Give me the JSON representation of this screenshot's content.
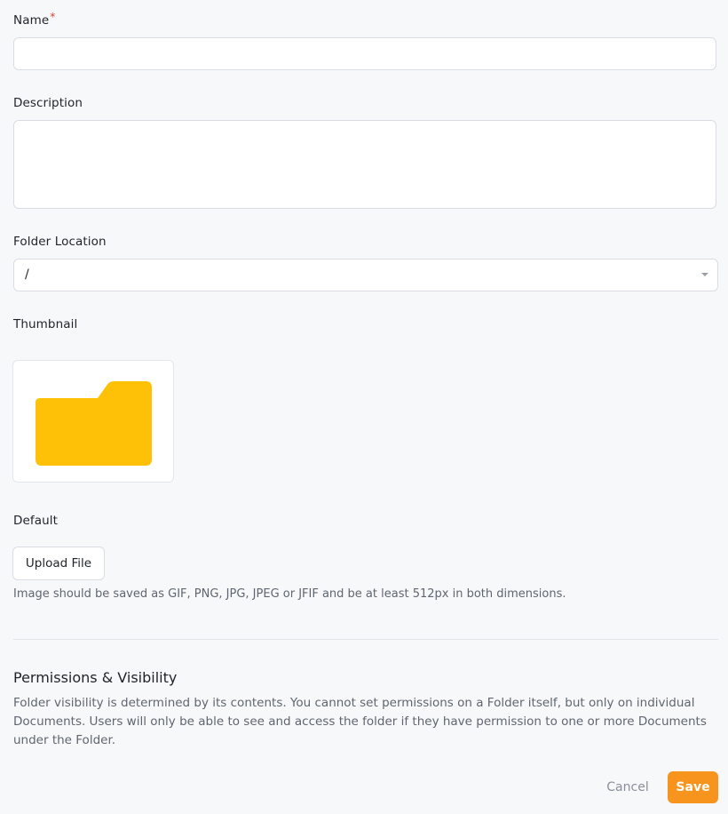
{
  "form": {
    "name": {
      "label": "Name",
      "required_mark": "*",
      "value": "",
      "placeholder": ""
    },
    "description": {
      "label": "Description",
      "value": "",
      "placeholder": ""
    },
    "folder_location": {
      "label": "Folder Location",
      "selected": "/"
    },
    "thumbnail": {
      "label": "Thumbnail",
      "preview_icon": "folder-icon",
      "preview_color": "#FFC107",
      "default_label": "Default",
      "upload_button": "Upload File",
      "hint": "Image should be saved as GIF, PNG, JPG, JPEG or JFIF and be at least 512px in both dimensions."
    }
  },
  "permissions": {
    "title": "Permissions & Visibility",
    "description": "Folder visibility is determined by its contents. You cannot set permissions on a Folder itself, but only on individual Documents. Users will only be able to see and access the folder if they have permission to one or more Documents under the Folder."
  },
  "actions": {
    "cancel_label": "Cancel",
    "save_label": "Save",
    "save_color": "#F7941D"
  }
}
